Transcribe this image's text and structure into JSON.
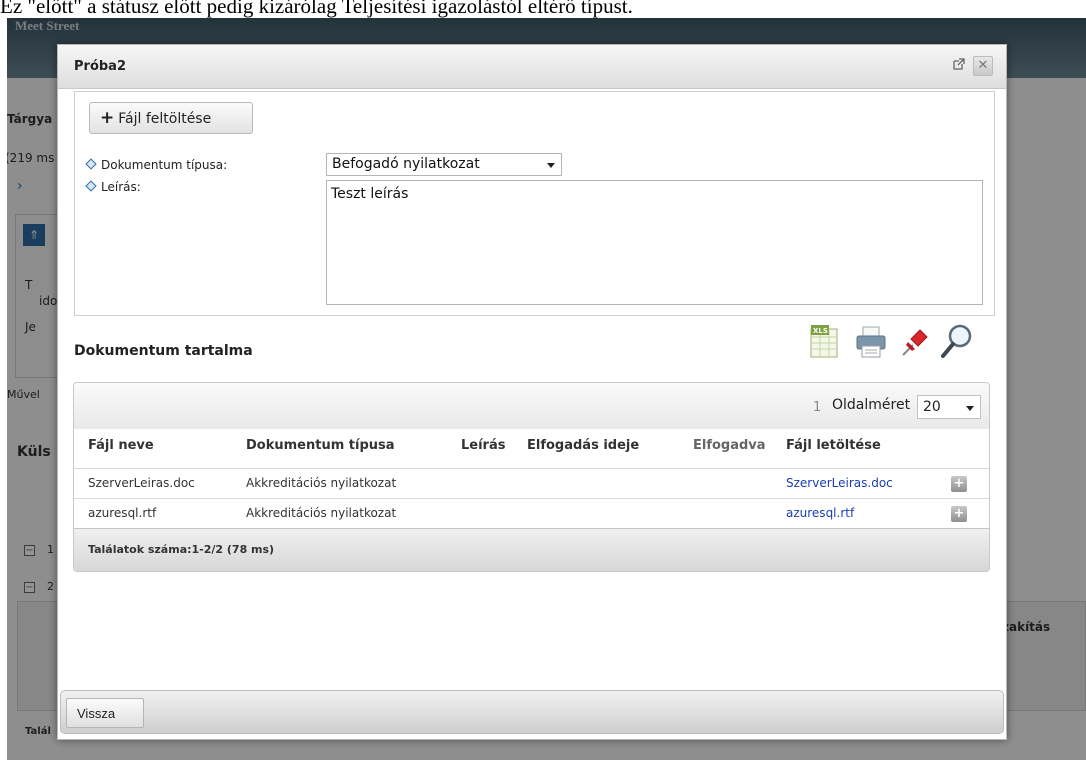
{
  "document_text": "Ez \"előtt\" a státusz előtt pedig kizárólag Teljesítési igazolástól eltérő típust.",
  "background": {
    "brand": "Meet Street",
    "labels": [
      "Tárgya",
      "(219 ms",
      "Művel",
      "Küls",
      "zakítás",
      "Talál",
      "1",
      "2"
    ],
    "side_labels": [
      "T",
      "ido",
      "Je"
    ]
  },
  "modal": {
    "title": "Próba2",
    "upload_button": "Fájl feltöltése",
    "document_type_label": "Dokumentum típusa:",
    "document_type_value": "Befogadó nyilatkozat",
    "description_label": "Leírás:",
    "description_value": "Teszt leírás",
    "section_title": "Dokumentum tartalma",
    "toolbar_icons": [
      "excel-export-icon",
      "print-icon",
      "pin-icon",
      "search-icon"
    ],
    "grid": {
      "current_page": "1",
      "page_size_label": "Oldalméret",
      "page_size_value": "20",
      "columns": [
        "Fájl neve",
        "Dokumentum típusa",
        "Leírás",
        "Elfogadás ideje",
        "Elfogadva",
        "Fájl letöltése"
      ],
      "rows": [
        {
          "file_name": "SzerverLeiras.doc",
          "doc_type": "Akkreditációs nyilatkozat",
          "download": "SzerverLeiras.doc"
        },
        {
          "file_name": "azuresql.rtf",
          "doc_type": "Akkreditációs nyilatkozat",
          "download": "azuresql.rtf"
        }
      ],
      "footer": "Találatok száma:1-2/2 (78 ms)"
    },
    "back_button": "Vissza"
  },
  "colors": {
    "link": "#1a3fb0",
    "bullet": "#2f6ea5",
    "header_bg": "#3f5666"
  }
}
